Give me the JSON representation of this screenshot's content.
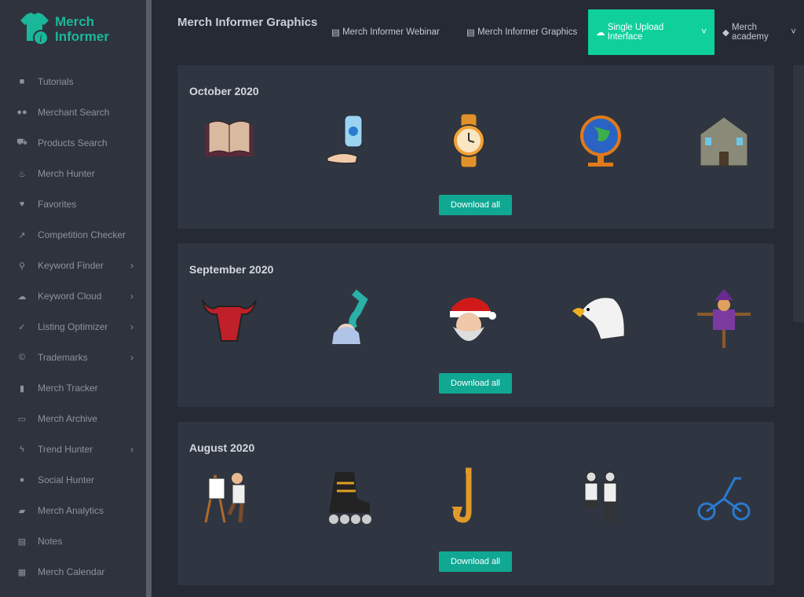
{
  "brand": {
    "line1": "Merch",
    "line2": "Informer",
    "color": "#1bb79a"
  },
  "sidebar": {
    "items": [
      {
        "label": "Tutorials",
        "icon": "video-icon",
        "chevron": false
      },
      {
        "label": "Merchant Search",
        "icon": "users-icon",
        "chevron": false
      },
      {
        "label": "Products Search",
        "icon": "cart-icon",
        "chevron": false
      },
      {
        "label": "Merch Hunter",
        "icon": "fire-icon",
        "chevron": false
      },
      {
        "label": "Favorites",
        "icon": "heart-icon",
        "chevron": false
      },
      {
        "label": "Competition Checker",
        "icon": "trend-icon",
        "chevron": false
      },
      {
        "label": "Keyword Finder",
        "icon": "search-icon",
        "chevron": true
      },
      {
        "label": "Keyword Cloud",
        "icon": "cloud-icon",
        "chevron": true
      },
      {
        "label": "Listing Optimizer",
        "icon": "check-icon",
        "chevron": true
      },
      {
        "label": "Trademarks",
        "icon": "copyright-icon",
        "chevron": true
      },
      {
        "label": "Merch Tracker",
        "icon": "bar-chart-icon",
        "chevron": false
      },
      {
        "label": "Merch Archive",
        "icon": "archive-icon",
        "chevron": false
      },
      {
        "label": "Trend Hunter",
        "icon": "bolt-icon",
        "chevron": true
      },
      {
        "label": "Social Hunter",
        "icon": "chat-icon",
        "chevron": false
      },
      {
        "label": "Merch Analytics",
        "icon": "book-icon",
        "chevron": false
      },
      {
        "label": "Notes",
        "icon": "note-icon",
        "chevron": false
      },
      {
        "label": "Merch Calendar",
        "icon": "calendar-icon",
        "chevron": false
      }
    ]
  },
  "header": {
    "title": "Merch Informer Graphics",
    "nav": [
      {
        "label": "Merch Informer Webinar",
        "icon": "file-icon",
        "active": false
      },
      {
        "label": "Merch Informer Graphics",
        "icon": "file-icon",
        "active": false
      },
      {
        "label": "Single Upload Interface",
        "icon": "cloud-upload-icon",
        "active": true,
        "dropdown": true
      },
      {
        "label": "Merch academy",
        "icon": "graduation-cap-icon",
        "active": false,
        "dropdown": true
      }
    ]
  },
  "accent": "#0fd09a",
  "months": [
    {
      "title": "October 2020",
      "graphics": [
        "book",
        "hand-sanitizer",
        "wristwatch",
        "globe",
        "house"
      ],
      "button": "Download all"
    },
    {
      "title": "September 2020",
      "graphics": [
        "bull",
        "mermaid",
        "santa",
        "eagle",
        "scarecrow"
      ],
      "button": "Download all"
    },
    {
      "title": "August 2020",
      "graphics": [
        "painter",
        "rollerblade",
        "saxophone",
        "couple",
        "tricycle"
      ],
      "button": "Download all"
    }
  ]
}
